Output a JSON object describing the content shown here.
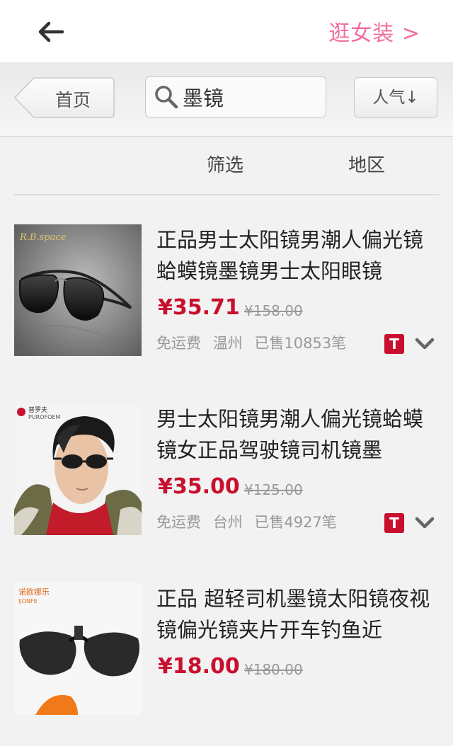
{
  "header": {
    "back_icon": "left-arrow-icon",
    "link": "逛女装 >"
  },
  "toolbar": {
    "home": "首页",
    "search_value": "墨镜",
    "sort": "人气↓"
  },
  "filters": {
    "filter": "筛选",
    "region": "地区"
  },
  "colors": {
    "accent_pink": "#f06ea0",
    "price_red": "#c8102e"
  },
  "products": [
    {
      "title": "正品男士太阳镜男潮人偏光镜蛤蟆镜墨镜男士太阳眼镜",
      "price": "¥35.71",
      "old_price": "¥158.00",
      "shipping": "免运费",
      "location": "温州",
      "sold": "已售10853笔",
      "badge": "T",
      "brand": "R.B.space"
    },
    {
      "title": "男士太阳镜男潮人偏光镜蛤蟆镜女正品驾驶镜司机镜墨",
      "price": "¥35.00",
      "old_price": "¥125.00",
      "shipping": "免运费",
      "location": "台州",
      "sold": "已售4927笔",
      "badge": "T",
      "brand": "普罗夫"
    },
    {
      "title": "正品 超轻司机墨镜太阳镜夜视镜偏光镜夹片开车钓鱼近",
      "price": "¥18.00",
      "old_price": "¥180.00",
      "brand": "诺欧娜乐"
    }
  ]
}
